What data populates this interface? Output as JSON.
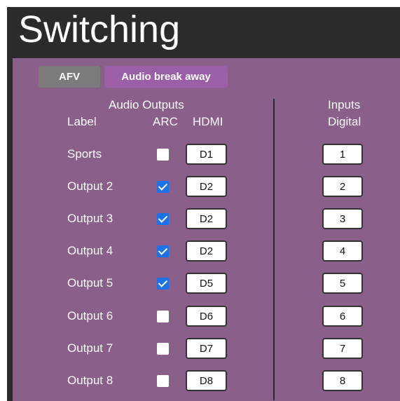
{
  "page": {
    "title": "Switching"
  },
  "tabs": {
    "afv": "AFV",
    "audio_break_away": "Audio break away"
  },
  "headers": {
    "audio_outputs": "Audio Outputs",
    "label": "Label",
    "arc": "ARC",
    "hdmi": "HDMI",
    "inputs": "Inputs",
    "digital": "Digital"
  },
  "rows": [
    {
      "label": "Sports",
      "arc": false,
      "hdmi": "D1",
      "input": "1"
    },
    {
      "label": "Output 2",
      "arc": true,
      "hdmi": "D2",
      "input": "2"
    },
    {
      "label": "Output 3",
      "arc": true,
      "hdmi": "D2",
      "input": "3"
    },
    {
      "label": "Output 4",
      "arc": true,
      "hdmi": "D2",
      "input": "4"
    },
    {
      "label": "Output 5",
      "arc": true,
      "hdmi": "D5",
      "input": "5"
    },
    {
      "label": "Output 6",
      "arc": false,
      "hdmi": "D6",
      "input": "6"
    },
    {
      "label": "Output 7",
      "arc": false,
      "hdmi": "D7",
      "input": "7"
    },
    {
      "label": "Output 8",
      "arc": false,
      "hdmi": "D8",
      "input": "8"
    }
  ],
  "colors": {
    "panel": "#8a608a",
    "frame": "#2b2b2b",
    "tab_afv": "#7b7b7b",
    "tab_active": "#9b5fa8",
    "checkbox_checked": "#1a73e8"
  }
}
